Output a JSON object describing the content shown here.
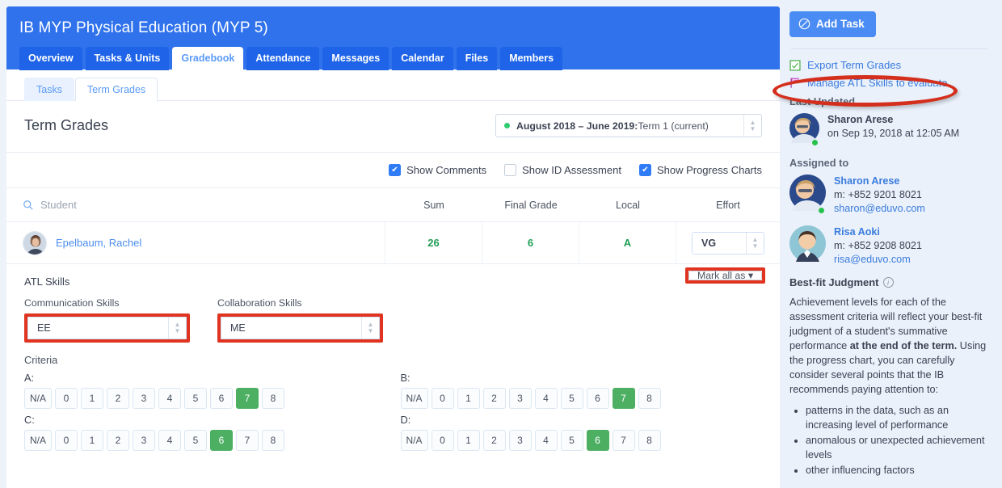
{
  "header": {
    "course_title": "IB MYP Physical Education (MYP 5)",
    "nav_tabs": [
      {
        "label": "Overview",
        "active": false
      },
      {
        "label": "Tasks & Units",
        "active": false
      },
      {
        "label": "Gradebook",
        "active": true
      },
      {
        "label": "Attendance",
        "active": false
      },
      {
        "label": "Messages",
        "active": false
      },
      {
        "label": "Calendar",
        "active": false
      },
      {
        "label": "Files",
        "active": false
      },
      {
        "label": "Members",
        "active": false
      }
    ]
  },
  "sub_tabs": [
    {
      "label": "Tasks",
      "active": false
    },
    {
      "label": "Term Grades",
      "active": true
    }
  ],
  "section": {
    "title": "Term Grades",
    "term_selector": {
      "range": "August 2018 – June 2019:",
      "term": " Term 1 (current)",
      "status_color": "#2ecc71"
    }
  },
  "options": [
    {
      "label": "Show Comments",
      "checked": true
    },
    {
      "label": "Show ID Assessment",
      "checked": false
    },
    {
      "label": "Show Progress Charts",
      "checked": true
    }
  ],
  "table": {
    "search_placeholder": "Student",
    "columns": [
      "Sum",
      "Final Grade",
      "Local",
      "Effort"
    ],
    "row": {
      "student_name": "Epelbaum, Rachel",
      "sum": "26",
      "final_grade": "6",
      "local": "A",
      "effort_value": "VG"
    }
  },
  "atl": {
    "title": "ATL Skills",
    "mark_all_label": "Mark all as",
    "skills": [
      {
        "label": "Communication Skills",
        "value": "EE",
        "highlighted": true
      },
      {
        "label": "Collaboration Skills",
        "value": "ME",
        "highlighted": true
      }
    ]
  },
  "criteria": {
    "title": "Criteria",
    "scale": [
      "N/A",
      "0",
      "1",
      "2",
      "3",
      "4",
      "5",
      "6",
      "7",
      "8"
    ],
    "items": [
      {
        "letter": "A:",
        "selected": "7"
      },
      {
        "letter": "B:",
        "selected": "7"
      },
      {
        "letter": "C:",
        "selected": "6"
      },
      {
        "letter": "D:",
        "selected": "6"
      }
    ],
    "selected_color": "#4caf62"
  },
  "sidebar": {
    "add_task_label": "Add Task",
    "links": [
      {
        "label": "Export Term Grades",
        "icon": "export-spreadsheet-icon"
      },
      {
        "label": "Manage ATL Skills to evaluate",
        "icon": "flag-skills-icon",
        "annotated": true
      }
    ],
    "last_updated": {
      "heading": "Last Updated",
      "name": "Sharon Arese",
      "timestamp": "on Sep 19, 2018 at 12:05 AM"
    },
    "assigned_to": {
      "heading": "Assigned to",
      "people": [
        {
          "name": "Sharon Arese",
          "phone": "m: +852 9201 8021",
          "email": "sharon@eduvo.com",
          "online": true
        },
        {
          "name": "Risa Aoki",
          "phone": "m: +852 9208 8021",
          "email": "risa@eduvo.com",
          "online": false
        }
      ]
    },
    "best_fit": {
      "title": "Best-fit Judgment",
      "paragraph_1": "Achievement levels for each of the assessment criteria will reflect your best-fit judgment of a student's summative performance ",
      "paragraph_bold": "at the end of the term.",
      "paragraph_2": " Using the progress chart, you can carefully consider several points that the IB recommends paying attention to:",
      "bullets": [
        "patterns in the data, such as an increasing level of performance",
        "anomalous or unexpected achievement levels",
        "other influencing factors"
      ]
    }
  },
  "annotation": {
    "highlight_color": "#d32f1c"
  }
}
